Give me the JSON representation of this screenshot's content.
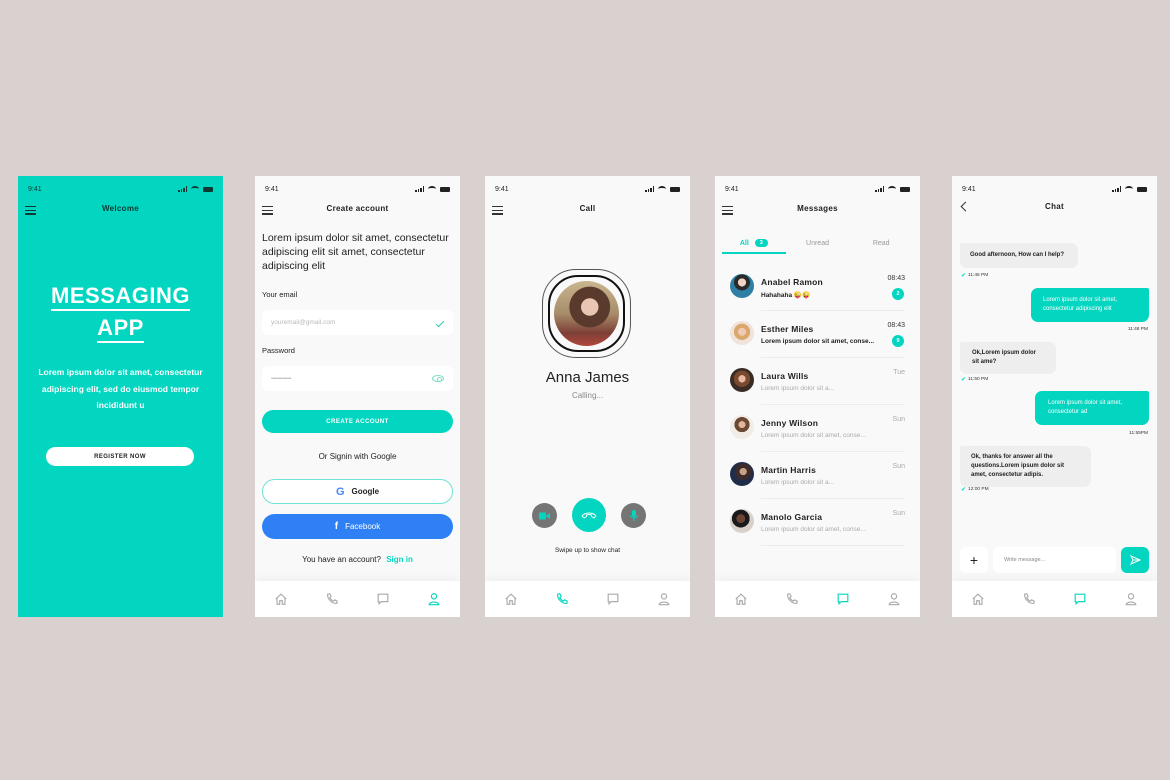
{
  "theme": {
    "accent": "#02d6c0",
    "background": "#d9d1cf",
    "facebook": "#2f80f4"
  },
  "status_bar": {
    "time": "9:41"
  },
  "welcome": {
    "header": "Welcome",
    "title_line1": "MESSAGING",
    "title_line2": "APP",
    "description": "Lorem ipsum dolor sit amet, consectetur adipiscing elit, sed do eiusmod tempor incididunt u",
    "register_button": "REGISTER NOW"
  },
  "create_account": {
    "header": "Create account",
    "lead": "Lorem ipsum dolor sit amet, consectetur adipiscing elit  sit amet, consectetur adipiscing elit",
    "email_label": "Your email",
    "email_placeholder": "youremail@gmail.com",
    "password_label": "Password",
    "password_value": "••••••••••••••••",
    "create_button": "CREATE ACCOUNT",
    "or_text": "Or Signin with Google",
    "google_button": "Google",
    "google_glyph": "G",
    "facebook_button": "Facebook",
    "facebook_glyph": "f",
    "have_account": "You have an account?",
    "sign_in": "Sign in"
  },
  "call": {
    "header": "Call",
    "callee_name": "Anna James",
    "status": "Calling...",
    "swipe_hint": "Swipe up to show chat"
  },
  "messages": {
    "header": "Messages",
    "tabs": [
      {
        "label": "All",
        "badge": "3"
      },
      {
        "label": "Unread"
      },
      {
        "label": "Read"
      }
    ],
    "items": [
      {
        "name": "Anabel Ramon",
        "preview": "Hahahaha 😜😜",
        "time": "08:43",
        "unread_count": "2"
      },
      {
        "name": "Esther Miles",
        "preview": "Lorem ipsum dolor sit amet, conse...",
        "time": "08:43",
        "unread_count": "9"
      },
      {
        "name": "Laura Wills",
        "preview": "Lorem ipsum dolor sit a...",
        "time": "Tue"
      },
      {
        "name": "Jenny Wilson",
        "preview": "Lorem ipsum dolor sit amet, conse...",
        "time": "Sun"
      },
      {
        "name": "Martin Harris",
        "preview": "Lorem ipsum dolor sit a...",
        "time": "Sun"
      },
      {
        "name": "Manolo Garcia",
        "preview": "Lorem ipsum dolor sit amet, conse...",
        "time": "Sun"
      }
    ]
  },
  "chat": {
    "header": "Chat",
    "messages": [
      {
        "direction": "in",
        "text": "Good afternoon, How can I help?",
        "time": "11:45 PM"
      },
      {
        "direction": "out",
        "text": "Lorem ipsum dolor sit amet, consectetur adipiscing elit",
        "time": "11:48 PM"
      },
      {
        "direction": "in",
        "text": "Ok,Lorem ipsum dolor sit ame?",
        "time": "11:50 PM"
      },
      {
        "direction": "out",
        "text": "Lorem ipsum dolor sit amet, consectetur ad",
        "time": "11:55PM"
      },
      {
        "direction": "in",
        "text": "Ok, thanks for answer all the questions.Lorem ipsum dolor sit amet, consectetur adipis.",
        "time": "12:00 PM"
      }
    ],
    "input_placeholder": "Write message...",
    "plus_glyph": "+",
    "tick_glyph": "✔"
  },
  "bottom_nav": {
    "items": [
      "home",
      "calls",
      "messages",
      "profile"
    ],
    "active_by_screen": {
      "create_account": "profile",
      "call": "calls",
      "messages": "messages",
      "chat": "messages"
    }
  }
}
